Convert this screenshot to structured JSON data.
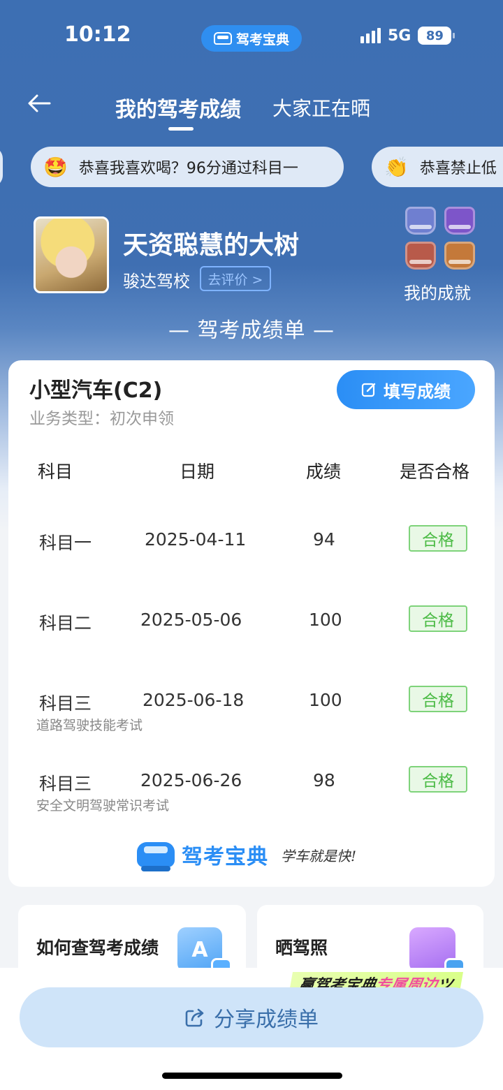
{
  "status": {
    "time": "10:12",
    "app_name": "驾考宝典",
    "network": "5G",
    "battery": "89"
  },
  "nav": {
    "tab_active": "我的驾考成绩",
    "tab_other": "大家正在晒"
  },
  "pills": [
    {
      "emoji": "🤩",
      "text": "恭喜我喜欢喝？96分通过科目一"
    },
    {
      "emoji": "👏",
      "text": "恭喜禁止低"
    }
  ],
  "profile": {
    "name": "天资聪慧的大树",
    "school": "骏达驾校",
    "rate_label": "去评价 >",
    "achievement_label": "我的成就"
  },
  "sheet_title": "— 驾考成绩单 —",
  "card": {
    "license_type": "小型汽车(C2)",
    "business_type": "业务类型：初次申领",
    "fill_button": "填写成绩",
    "headers": [
      "科目",
      "日期",
      "成绩",
      "是否合格"
    ],
    "rows": [
      {
        "subject": "科目一",
        "date": "2025-04-11",
        "score": "94",
        "result": "合格",
        "note": ""
      },
      {
        "subject": "科目二",
        "date": "2025-05-06",
        "score": "100",
        "result": "合格",
        "note": ""
      },
      {
        "subject": "科目三",
        "date": "2025-06-18",
        "score": "100",
        "result": "合格",
        "note": "道路驾驶技能考试"
      },
      {
        "subject": "科目三",
        "date": "2025-06-26",
        "score": "98",
        "result": "合格",
        "note": "安全文明驾驶常识考试"
      }
    ],
    "brand_name": "驾考宝典",
    "brand_slogan": "学车就是快!"
  },
  "tiles": [
    {
      "label": "如何查驾考成绩",
      "icon": "document-search-icon",
      "art_letter": "A"
    },
    {
      "label": "晒驾照",
      "icon": "photo-share-icon"
    }
  ],
  "promo": {
    "prefix": "赢驾考宝典",
    "highlight": "专属周边",
    "suffix": "ツ"
  },
  "share_button": "分享成绩单",
  "colors": {
    "hero": "#3d6fb3",
    "accent": "#2b8ef5",
    "pass": "#4cbb46"
  }
}
